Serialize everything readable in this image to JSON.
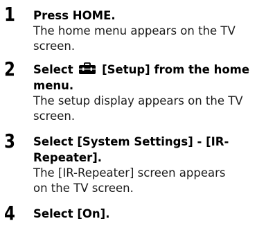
{
  "steps": [
    {
      "number": "1",
      "title_lines": [
        "Press HOME."
      ],
      "desc_lines": [
        "The home menu appears on the TV",
        "screen."
      ]
    },
    {
      "number": "2",
      "title_before_icon": "Select",
      "title_icon": "toolbox-icon",
      "title_after_icon": "[Setup] from the home",
      "title_line2": "menu.",
      "desc_lines": [
        "The setup display appears on the TV",
        "screen."
      ]
    },
    {
      "number": "3",
      "title_lines": [
        "Select [System Settings] - [IR-",
        "Repeater]."
      ],
      "desc_lines": [
        "The [IR-Repeater] screen appears",
        "on the TV screen."
      ]
    },
    {
      "number": "4",
      "title_lines": [
        "Select [On]."
      ],
      "desc_lines": []
    }
  ]
}
